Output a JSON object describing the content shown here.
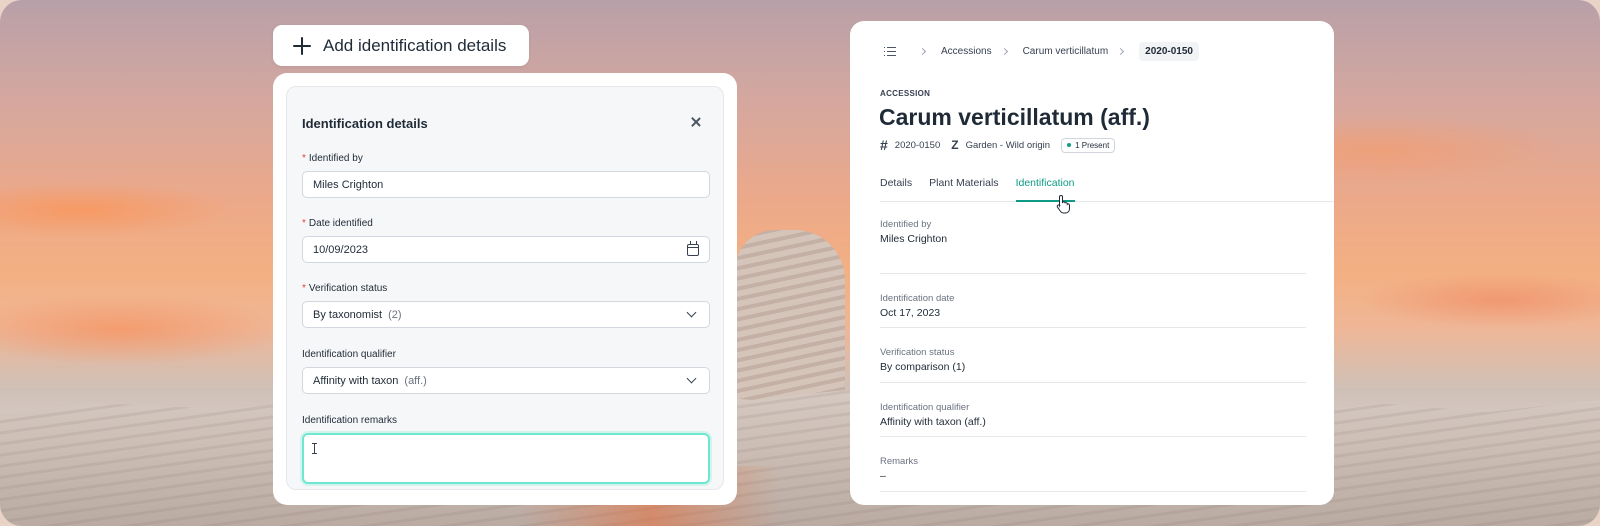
{
  "add_button": {
    "label": "Add identification details",
    "icon": "plus-icon"
  },
  "form": {
    "title": "Identification details",
    "close_icon": "close-icon",
    "fields": {
      "identified_by": {
        "label": "Identified by",
        "required": true,
        "value": "Miles Crighton"
      },
      "date_identified": {
        "label": "Date identified",
        "required": true,
        "value": "10/09/2023",
        "icon": "calendar-icon"
      },
      "verification_status": {
        "label": "Verification status",
        "required": true,
        "value": "By taxonomist",
        "suffix": "(2)"
      },
      "identification_qualifier": {
        "label": "Identification qualifier",
        "required": false,
        "value": "Affinity with taxon",
        "suffix": "(aff.)"
      },
      "identification_remarks": {
        "label": "Identification remarks",
        "required": false,
        "value": ""
      }
    }
  },
  "detail": {
    "breadcrumb": {
      "icon": "list-icon",
      "items": [
        "Accessions",
        "Carum verticillatum",
        "2020-0150"
      ]
    },
    "eyebrow": "ACCESSION",
    "title": "Carum verticillatum (aff.)",
    "meta": {
      "accession_number": "2020-0150",
      "origin": "Garden - Wild origin",
      "badge": "1 Present"
    },
    "tabs": [
      {
        "label": "Details",
        "active": false
      },
      {
        "label": "Plant Materials",
        "active": false
      },
      {
        "label": "Identification",
        "active": true
      }
    ],
    "rows": [
      {
        "label": "Identified by",
        "value": "Miles Crighton"
      },
      {
        "label": "Identification date",
        "value": "Oct 17, 2023"
      },
      {
        "label": "Verification status",
        "value": "By comparison (1)"
      },
      {
        "label": "Identification qualifier",
        "value": "Affinity with taxon (aff.)"
      },
      {
        "label": "Remarks",
        "value": "–"
      }
    ]
  },
  "colors": {
    "accent": "#0e9a84",
    "required": "#e0463b",
    "focus_ring": "#6ee7d0"
  }
}
